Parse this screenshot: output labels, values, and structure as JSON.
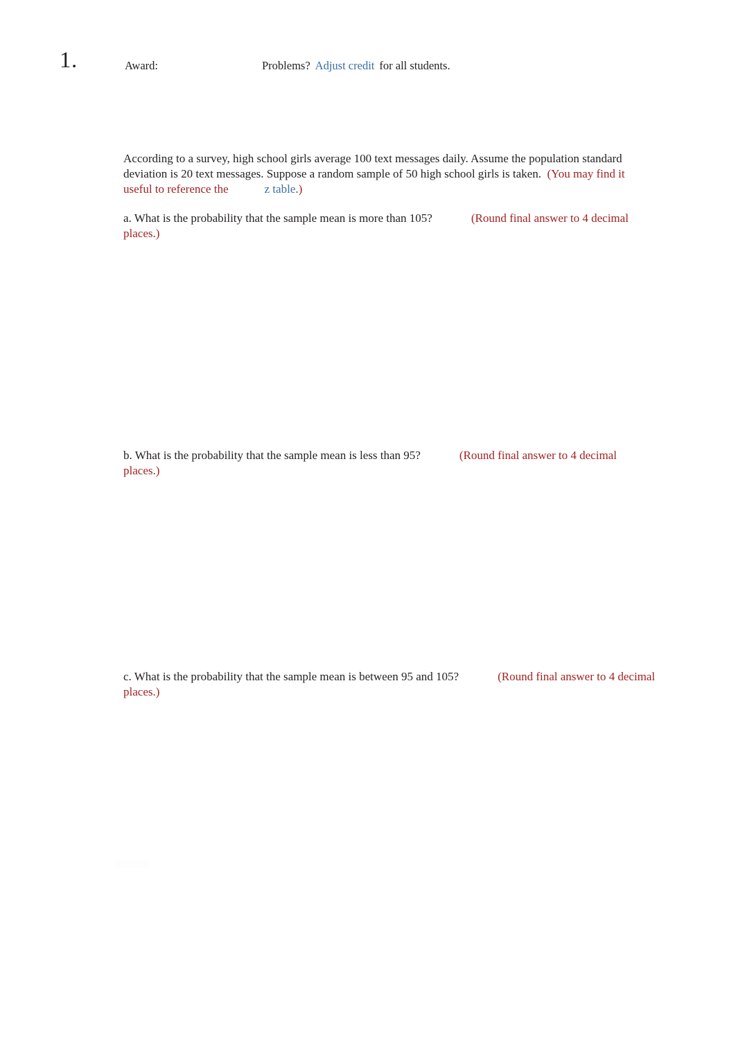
{
  "header": {
    "question_number": "1.",
    "award_label": "Award:",
    "award_value": "",
    "problems_label": "Problems?",
    "adjust_credit_link": "Adjust credit",
    "for_all_students": "for all students."
  },
  "question": {
    "stem_line1": "According to a survey, high school girls average 100 text messages daily. Assume the population",
    "stem_line2": "standard deviation is 20 text messages. Suppose a random sample of 50 high school girls is",
    "stem_line3_black": "taken.",
    "stem_hint_open": "(You may find it useful to reference the",
    "z_table_link": "z table",
    "stem_hint_close": ".)",
    "parts": [
      {
        "letter": "a.",
        "text": "What is the probability that the sample mean is more than 105?",
        "instruction": "(Round final answer to 4 decimal places.)",
        "answer": ""
      },
      {
        "letter": "b.",
        "text": "What is the probability that the sample mean is less than 95?",
        "instruction": "(Round final answer to 4 decimal places.)",
        "answer": ""
      },
      {
        "letter": "c.",
        "text": "What is the probability that the sample mean is between 95 and 105?",
        "instruction": "(Round final answer to 4 decimal places.)",
        "answer": ""
      }
    ]
  },
  "colors": {
    "text": "#231f20",
    "link_blue": "#3a6ea5",
    "instruction_red": "#a02323",
    "page_background": "#ffffff"
  }
}
